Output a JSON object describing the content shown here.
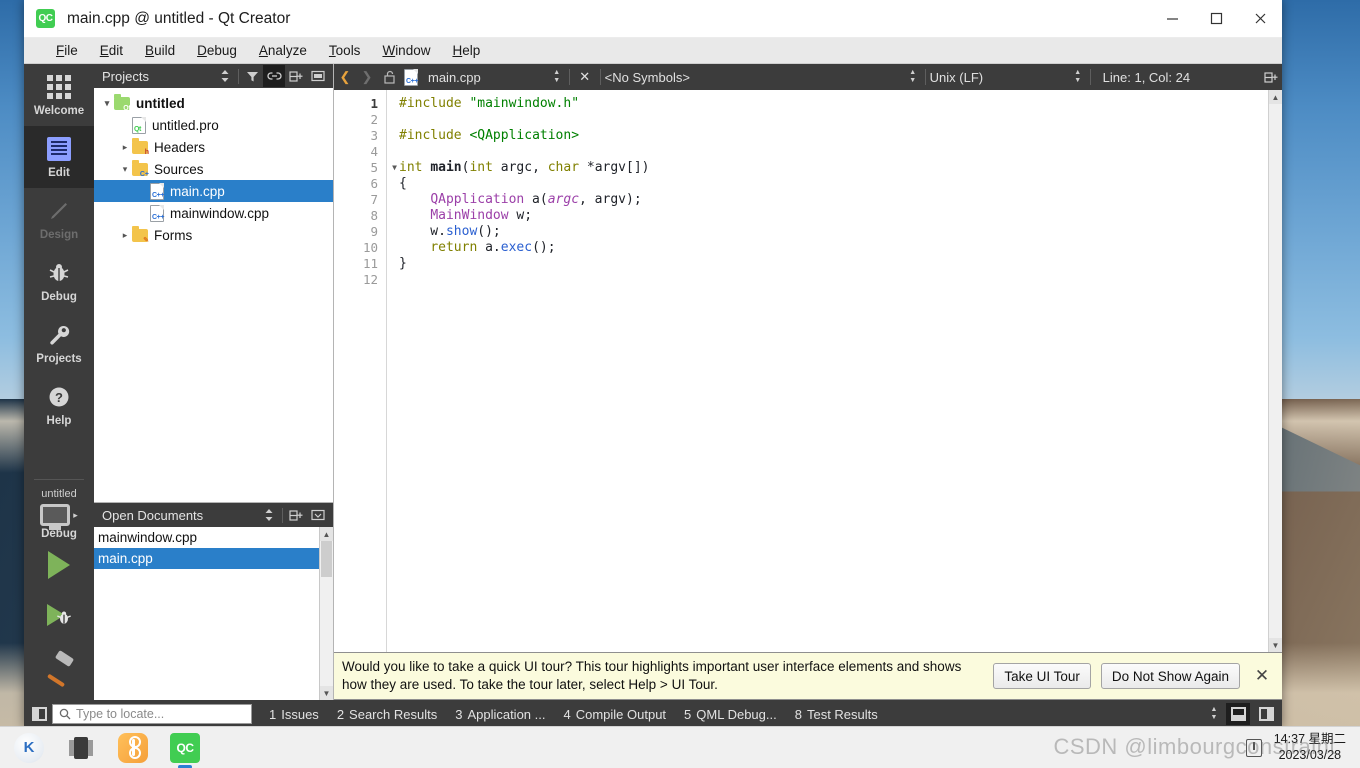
{
  "window": {
    "title": "main.cpp @ untitled - Qt Creator",
    "app_icon": "QC",
    "minimize": "─",
    "maximize": "□",
    "close": "✕"
  },
  "menubar": {
    "items": [
      {
        "label": "File",
        "mnemonic": "F"
      },
      {
        "label": "Edit",
        "mnemonic": "E"
      },
      {
        "label": "Build",
        "mnemonic": "B"
      },
      {
        "label": "Debug",
        "mnemonic": "D"
      },
      {
        "label": "Analyze",
        "mnemonic": "A"
      },
      {
        "label": "Tools",
        "mnemonic": "T"
      },
      {
        "label": "Window",
        "mnemonic": "W"
      },
      {
        "label": "Help",
        "mnemonic": "H"
      }
    ]
  },
  "modebar": {
    "modes": [
      {
        "label": "Welcome",
        "icon": "grid-icon",
        "state": "normal"
      },
      {
        "label": "Edit",
        "icon": "editor-icon",
        "state": "selected"
      },
      {
        "label": "Design",
        "icon": "pencil-icon",
        "state": "disabled"
      },
      {
        "label": "Debug",
        "icon": "bug-icon",
        "state": "normal"
      },
      {
        "label": "Projects",
        "icon": "wrench-icon",
        "state": "normal"
      },
      {
        "label": "Help",
        "icon": "question-icon",
        "state": "normal"
      }
    ],
    "kit": {
      "project": "untitled",
      "build_config": "Debug",
      "run_label": "run-button",
      "debug_label": "run-debug-button",
      "build_label": "build-button"
    }
  },
  "projects_panel": {
    "title": "Projects",
    "tree": [
      {
        "label": "untitled",
        "indent": 0,
        "arrow": "open",
        "icon": "qt-folder",
        "bold": true,
        "selected": false
      },
      {
        "label": "untitled.pro",
        "indent": 1,
        "arrow": "none",
        "icon": "qt-file",
        "bold": false,
        "selected": false
      },
      {
        "label": "Headers",
        "indent": 1,
        "arrow": "closed",
        "icon": "h-folder",
        "bold": false,
        "selected": false
      },
      {
        "label": "Sources",
        "indent": 1,
        "arrow": "open",
        "icon": "cpp-folder",
        "bold": false,
        "selected": false
      },
      {
        "label": "main.cpp",
        "indent": 2,
        "arrow": "none",
        "icon": "cpp-file",
        "bold": false,
        "selected": true
      },
      {
        "label": "mainwindow.cpp",
        "indent": 2,
        "arrow": "none",
        "icon": "cpp-file",
        "bold": false,
        "selected": false
      },
      {
        "label": "Forms",
        "indent": 1,
        "arrow": "closed",
        "icon": "forms-folder",
        "bold": false,
        "selected": false
      }
    ]
  },
  "open_documents": {
    "title": "Open Documents",
    "items": [
      {
        "label": "main.cpp",
        "selected": true
      },
      {
        "label": "mainwindow.cpp",
        "selected": false
      }
    ]
  },
  "editor_toolbar": {
    "filename": "main.cpp",
    "symbols": "<No Symbols>",
    "line_ending": "Unix (LF)",
    "cursor": "Line: 1, Col: 24"
  },
  "code": {
    "line_numbers": [
      "1",
      "2",
      "3",
      "4",
      "5",
      "6",
      "7",
      "8",
      "9",
      "10",
      "11",
      "12"
    ],
    "current_line": 1,
    "fold_line": 5,
    "lines": [
      [
        {
          "t": "#include ",
          "c": "pp"
        },
        {
          "t": "\"mainwindow.h\"",
          "c": "str"
        }
      ],
      [],
      [
        {
          "t": "#include ",
          "c": "pp"
        },
        {
          "t": "<QApplication>",
          "c": "str"
        }
      ],
      [],
      [
        {
          "t": "int ",
          "c": "k"
        },
        {
          "t": "main",
          "c": "fn"
        },
        {
          "t": "(",
          "c": "pl"
        },
        {
          "t": "int",
          "c": "k"
        },
        {
          "t": " argc, ",
          "c": "pl"
        },
        {
          "t": "char",
          "c": "k"
        },
        {
          "t": " *argv[])",
          "c": "pl"
        }
      ],
      [
        {
          "t": "{",
          "c": "pl"
        }
      ],
      [
        {
          "t": "    ",
          "c": "pl"
        },
        {
          "t": "QApplication",
          "c": "cls"
        },
        {
          "t": " a(",
          "c": "pl"
        },
        {
          "t": "argc",
          "c": "arg"
        },
        {
          "t": ", argv);",
          "c": "pl"
        }
      ],
      [
        {
          "t": "    ",
          "c": "pl"
        },
        {
          "t": "MainWindow",
          "c": "cls"
        },
        {
          "t": " w;",
          "c": "pl"
        }
      ],
      [
        {
          "t": "    w.",
          "c": "pl"
        },
        {
          "t": "show",
          "c": "mem"
        },
        {
          "t": "();",
          "c": "pl"
        }
      ],
      [
        {
          "t": "    ",
          "c": "pl"
        },
        {
          "t": "return",
          "c": "k"
        },
        {
          "t": " a.",
          "c": "pl"
        },
        {
          "t": "exec",
          "c": "mem"
        },
        {
          "t": "();",
          "c": "pl"
        }
      ],
      [
        {
          "t": "}",
          "c": "pl"
        }
      ],
      []
    ]
  },
  "infobar": {
    "message": "Would you like to take a quick UI tour? This tour highlights important user interface elements and shows how they are used. To take the tour later, select Help > UI Tour.",
    "primary_button": "Take UI Tour",
    "secondary_button": "Do Not Show Again",
    "close": "✕"
  },
  "statusbar": {
    "locator_placeholder": "Type to locate...",
    "panes": [
      {
        "num": "1",
        "label": "Issues"
      },
      {
        "num": "2",
        "label": "Search Results"
      },
      {
        "num": "3",
        "label": "Application ..."
      },
      {
        "num": "4",
        "label": "Compile Output"
      },
      {
        "num": "5",
        "label": "QML Debug..."
      },
      {
        "num": "8",
        "label": "Test Results"
      }
    ]
  },
  "taskbar": {
    "apps": [
      {
        "name": "kdevelop-icon",
        "glyph": "K"
      },
      {
        "name": "files-icon",
        "glyph": ""
      },
      {
        "name": "orange-app-icon",
        "glyph": ""
      },
      {
        "name": "qtcreator-icon",
        "glyph": "QC"
      }
    ],
    "clock_time": "14:37 星期二",
    "clock_date": "2023/03/28",
    "watermark": "CSDN @limbourgconstraint"
  },
  "colors": {
    "accent": "#2a7fc9",
    "qt_green": "#41cd52",
    "dark_chrome": "#3c3c3c",
    "infobar_bg": "#fbfbdd"
  }
}
